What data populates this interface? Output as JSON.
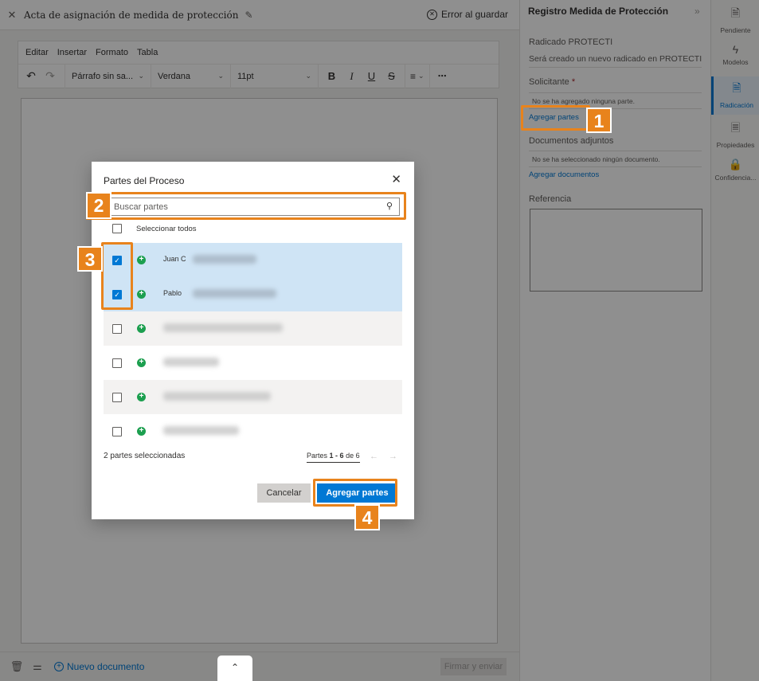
{
  "doc": {
    "close_icon": "close-icon",
    "title": "Acta de asignación de medida de protección",
    "edit_icon": "pencil-icon",
    "save_error": "Error al guardar"
  },
  "editor": {
    "menu": [
      "Editar",
      "Insertar",
      "Formato",
      "Tabla"
    ],
    "paragraph_style": "Párrafo sin sa...",
    "font": "Verdana",
    "size": "11pt",
    "bold": "B",
    "italic": "I",
    "underline": "U",
    "strike": "S"
  },
  "bottom": {
    "new_doc": "Nuevo documento",
    "sign_send": "Firmar y enviar"
  },
  "panel": {
    "title": "Registro Medida de Protección",
    "radicado_label": "Radicado PROTECTI",
    "radicado_text": "Será creado un nuevo radicado en PROTECTI",
    "solicitante_label": "Solicitante",
    "required_mark": "*",
    "no_party": "No se ha agregado ninguna parte.",
    "add_parties_link": "Agregar partes",
    "docs_label": "Documentos adjuntos",
    "no_docs": "No se ha seleccionado ningún documento.",
    "add_docs_link": "Agregar documentos",
    "reference_label": "Referencia"
  },
  "rail": [
    {
      "label": "Pendiente",
      "icon": "document-clock-icon"
    },
    {
      "label": "Modelos",
      "icon": "lightning-icon"
    },
    {
      "label": "Radicación",
      "icon": "document-search-icon"
    },
    {
      "label": "Propiedades",
      "icon": "document-list-icon"
    },
    {
      "label": "Confidencia...",
      "icon": "lock-icon"
    }
  ],
  "modal": {
    "title": "Partes del Proceso",
    "search_placeholder": "Buscar partes",
    "select_all": "Seleccionar todos",
    "parties": [
      {
        "name": "Juan C",
        "checked": true
      },
      {
        "name": "Pablo",
        "checked": true
      },
      {
        "name": "",
        "checked": false
      },
      {
        "name": "",
        "checked": false
      },
      {
        "name": "",
        "checked": false
      },
      {
        "name": "",
        "checked": false
      }
    ],
    "selected_count": "2 partes seleccionadas",
    "pager_prefix": "Partes",
    "pager_range": "1 - 6",
    "pager_suffix": "de 6",
    "cancel": "Cancelar",
    "add": "Agregar partes"
  },
  "callouts": [
    "1",
    "2",
    "3",
    "4"
  ],
  "colors": {
    "accent": "#0078d4",
    "callout": "#e8831c",
    "add_party_green": "#1c9f4f",
    "selected_row": "#cfe4f5"
  }
}
